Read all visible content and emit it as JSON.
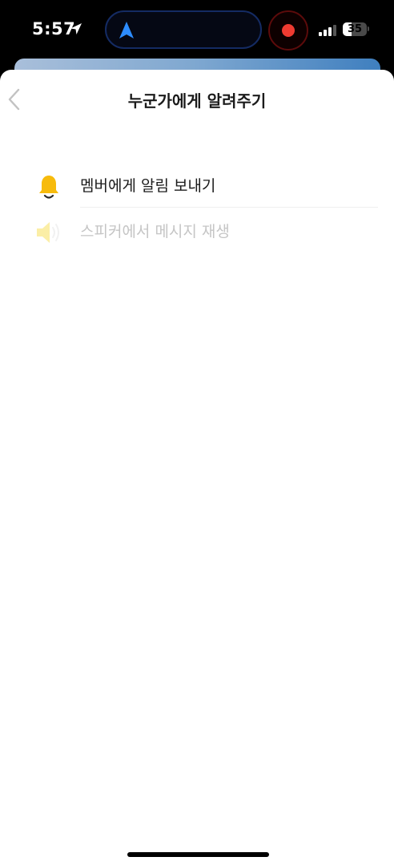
{
  "status_bar": {
    "time": "5:57",
    "battery_level": "35",
    "battery_fraction": 0.35,
    "recording": true
  },
  "header": {
    "back_icon": "chevron-left-icon",
    "title": "누군가에게 알려주기"
  },
  "menu": {
    "items": [
      {
        "label": "멤버에게 알림 보내기",
        "icon": "bell-icon",
        "icon_color": "#f7bb0c",
        "enabled": true
      },
      {
        "label": "스피커에서 메시지 재생",
        "icon": "speaker-icon",
        "icon_color": "#fbeea6",
        "enabled": false
      }
    ]
  },
  "colors": {
    "accent_blue": "#2d8cff",
    "record_red": "#ee3b31"
  }
}
